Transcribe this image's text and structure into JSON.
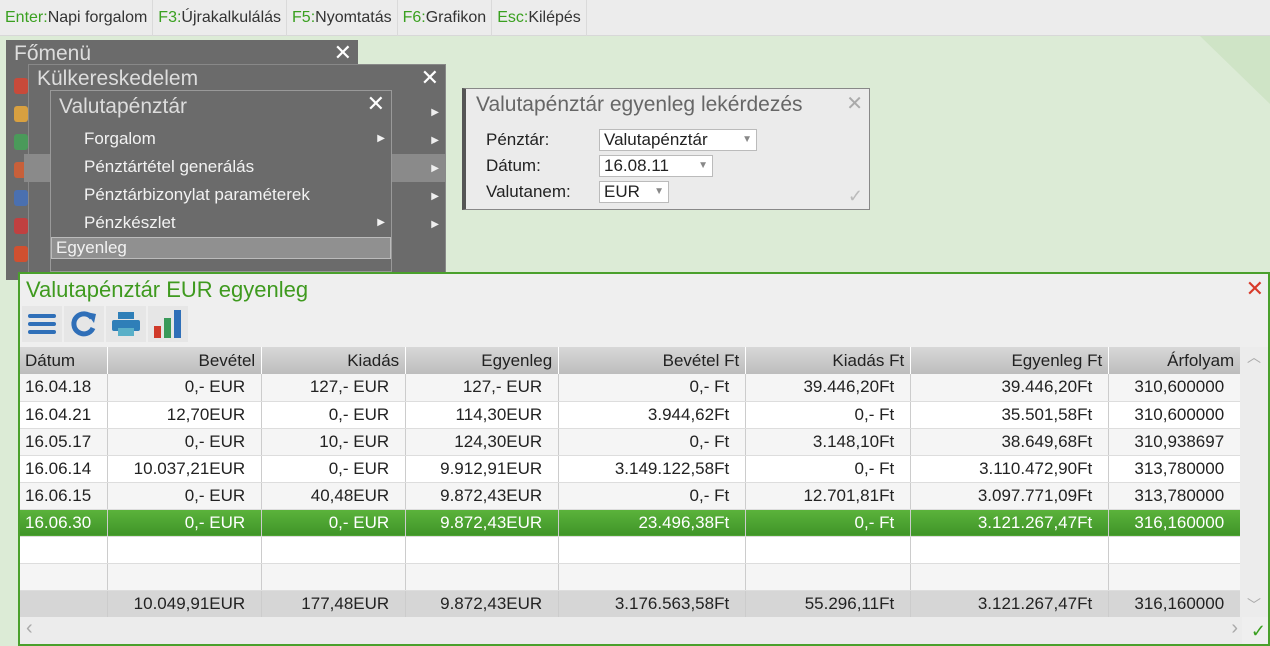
{
  "hotkeys": [
    {
      "key": "Enter:",
      "label": "Napi forgalom"
    },
    {
      "key": "F3:",
      "label": "Újrakalkulálás"
    },
    {
      "key": "F5:",
      "label": "Nyomtatás"
    },
    {
      "key": "F6:",
      "label": "Grafikon"
    },
    {
      "key": "Esc:",
      "label": "Kilépés"
    }
  ],
  "menus": {
    "main_title": "Főmenü",
    "sub_title": "Külkereskedelem",
    "sub2_title": "Valutapénztár",
    "items": [
      "Forgalom",
      "Pénztártétel generálás",
      "Pénztárbizonylat paraméterek",
      "Pénzkészlet",
      "Egyenleg"
    ]
  },
  "dialog": {
    "title": "Valutapénztár egyenleg lekérdezés",
    "fields": [
      {
        "label": "Pénztár:",
        "value": "Valutapénztár"
      },
      {
        "label": "Dátum:",
        "value": "16.08.11"
      },
      {
        "label": "Valutanem:",
        "value": "EUR"
      }
    ]
  },
  "panel": {
    "title": "Valutapénztár EUR egyenleg",
    "columns": [
      "Dátum",
      "Bevétel",
      "Kiadás",
      "Egyenleg",
      "Bevétel Ft",
      "Kiadás Ft",
      "Egyenleg Ft",
      "Árfolyam"
    ],
    "rows": [
      [
        "16.04.18",
        "0,- EUR",
        "127,- EUR",
        "127,- EUR",
        "0,- Ft",
        "39.446,20Ft",
        "39.446,20Ft",
        "310,600000"
      ],
      [
        "16.04.21",
        "12,70EUR",
        "0,- EUR",
        "114,30EUR",
        "3.944,62Ft",
        "0,- Ft",
        "35.501,58Ft",
        "310,600000"
      ],
      [
        "16.05.17",
        "0,- EUR",
        "10,- EUR",
        "124,30EUR",
        "0,- Ft",
        "3.148,10Ft",
        "38.649,68Ft",
        "310,938697"
      ],
      [
        "16.06.14",
        "10.037,21EUR",
        "0,- EUR",
        "9.912,91EUR",
        "3.149.122,58Ft",
        "0,- Ft",
        "3.110.472,90Ft",
        "313,780000"
      ],
      [
        "16.06.15",
        "0,- EUR",
        "40,48EUR",
        "9.872,43EUR",
        "0,- Ft",
        "12.701,81Ft",
        "3.097.771,09Ft",
        "313,780000"
      ],
      [
        "16.06.30",
        "0,- EUR",
        "0,- EUR",
        "9.872,43EUR",
        "23.496,38Ft",
        "0,- Ft",
        "3.121.267,47Ft",
        "316,160000"
      ]
    ],
    "totals": [
      "",
      "10.049,91EUR",
      "177,48EUR",
      "9.872,43EUR",
      "3.176.563,58Ft",
      "55.296,11Ft",
      "3.121.267,47Ft",
      "316,160000"
    ],
    "selected_row": 5
  },
  "colors": {
    "accent": "#3f9a1f",
    "menu": "#6b6b6b"
  }
}
